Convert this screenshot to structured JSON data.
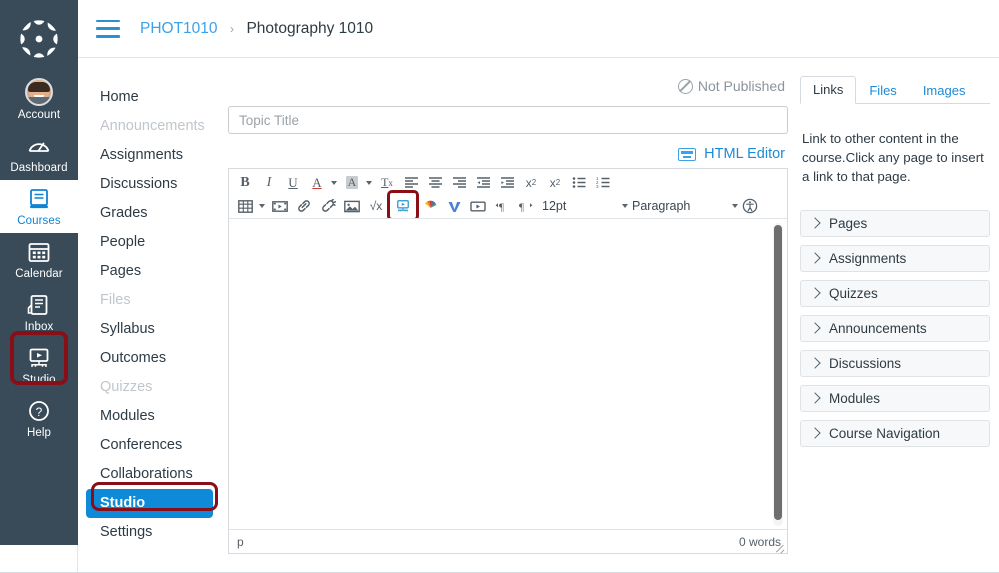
{
  "global_nav": {
    "logo_name": "canvas-logo",
    "items": [
      {
        "label": "Account",
        "icon": "avatar-icon",
        "active": false
      },
      {
        "label": "Dashboard",
        "icon": "dashboard-icon",
        "active": false
      },
      {
        "label": "Courses",
        "icon": "courses-icon",
        "active": true
      },
      {
        "label": "Calendar",
        "icon": "calendar-icon",
        "active": false
      },
      {
        "label": "Inbox",
        "icon": "inbox-icon",
        "active": false
      },
      {
        "label": "Studio",
        "icon": "studio-icon",
        "active": false
      },
      {
        "label": "Help",
        "icon": "help-icon",
        "active": false
      }
    ]
  },
  "topbar": {
    "menu_icon": "hamburger-icon",
    "breadcrumb_course_code": "PHOT1010",
    "breadcrumb_separator": "›",
    "breadcrumb_course_name": "Photography 1010"
  },
  "course_nav": {
    "items": [
      {
        "label": "Home",
        "state": "normal"
      },
      {
        "label": "Announcements",
        "state": "disabled"
      },
      {
        "label": "Assignments",
        "state": "normal"
      },
      {
        "label": "Discussions",
        "state": "normal"
      },
      {
        "label": "Grades",
        "state": "normal"
      },
      {
        "label": "People",
        "state": "normal"
      },
      {
        "label": "Pages",
        "state": "normal"
      },
      {
        "label": "Files",
        "state": "disabled"
      },
      {
        "label": "Syllabus",
        "state": "normal"
      },
      {
        "label": "Outcomes",
        "state": "normal"
      },
      {
        "label": "Quizzes",
        "state": "disabled"
      },
      {
        "label": "Modules",
        "state": "normal"
      },
      {
        "label": "Conferences",
        "state": "normal"
      },
      {
        "label": "Collaborations",
        "state": "normal"
      },
      {
        "label": "Studio",
        "state": "current"
      },
      {
        "label": "Settings",
        "state": "normal"
      }
    ]
  },
  "editor": {
    "publish_status": "Not Published",
    "publish_icon": "not-published-icon",
    "title_value": "",
    "title_placeholder": "Topic Title",
    "html_editor_label": "HTML Editor",
    "html_editor_icon": "keyboard-icon",
    "toolbar_row1": [
      {
        "name": "bold-button",
        "glyph": "B",
        "style": "bold"
      },
      {
        "name": "italic-button",
        "glyph": "I",
        "style": "italic"
      },
      {
        "name": "underline-button",
        "glyph": "U",
        "style": "underline"
      },
      {
        "name": "text-color-button",
        "glyph": "A",
        "style": "colortext"
      },
      {
        "name": "text-color-dropdown",
        "glyph": "",
        "style": "caret"
      },
      {
        "name": "highlight-color-button",
        "glyph": "A",
        "style": "highlight"
      },
      {
        "name": "highlight-color-dropdown",
        "glyph": "",
        "style": "caret"
      },
      {
        "name": "clear-formatting-button",
        "glyph": "Tx",
        "style": "clearfmt"
      },
      {
        "name": "align-left-button",
        "glyph": "",
        "style": "align-left"
      },
      {
        "name": "align-center-button",
        "glyph": "",
        "style": "align-center"
      },
      {
        "name": "align-right-button",
        "glyph": "",
        "style": "align-right"
      },
      {
        "name": "outdent-button",
        "glyph": "",
        "style": "outdent"
      },
      {
        "name": "indent-button",
        "glyph": "",
        "style": "indent"
      },
      {
        "name": "superscript-button",
        "glyph": "x²",
        "style": "sup"
      },
      {
        "name": "subscript-button",
        "glyph": "x₂",
        "style": "sub"
      },
      {
        "name": "bulleted-list-button",
        "glyph": "",
        "style": "ul"
      },
      {
        "name": "numbered-list-button",
        "glyph": "",
        "style": "ol"
      }
    ],
    "toolbar_row2": [
      {
        "name": "table-button",
        "style": "table"
      },
      {
        "name": "table-dropdown",
        "style": "caret"
      },
      {
        "name": "media-button",
        "style": "film"
      },
      {
        "name": "link-button",
        "style": "link"
      },
      {
        "name": "unlink-button",
        "style": "unlink"
      },
      {
        "name": "image-button",
        "style": "image"
      },
      {
        "name": "math-equation-button",
        "style": "math"
      },
      {
        "name": "studio-button",
        "style": "studio"
      },
      {
        "name": "nbc-learn-button",
        "style": "nbc"
      },
      {
        "name": "vimeo-button",
        "style": "vimeo"
      },
      {
        "name": "video-embed-button",
        "style": "video"
      },
      {
        "name": "ltr-button",
        "style": "ltr"
      },
      {
        "name": "rtl-button",
        "style": "rtl"
      }
    ],
    "font_size": "12pt",
    "block_format": "Paragraph",
    "accessibility_icon": "accessibility-checker-icon",
    "body_content": "",
    "status_path": "p",
    "word_count": "0 words",
    "resize_handle": "resize-grip"
  },
  "right_panel": {
    "tabs": [
      {
        "label": "Links",
        "active": true
      },
      {
        "label": "Files",
        "active": false
      },
      {
        "label": "Images",
        "active": false
      }
    ],
    "description": "Link to other content in the course.Click any page to insert a link to that page.",
    "accordion": [
      {
        "label": "Pages"
      },
      {
        "label": "Assignments"
      },
      {
        "label": "Quizzes"
      },
      {
        "label": "Announcements"
      },
      {
        "label": "Discussions"
      },
      {
        "label": "Modules"
      },
      {
        "label": "Course Navigation"
      }
    ]
  },
  "annotations": {
    "color": "#8a0e16",
    "targets": [
      "global-nav-studio",
      "course-nav-studio",
      "toolbar-studio-button"
    ]
  },
  "colors": {
    "global_nav_bg": "#394b58",
    "active_blue": "#0e8ad8",
    "link_blue": "#1e8ad6",
    "text_dark": "#2d3b45",
    "muted": "#c0c6cb"
  }
}
